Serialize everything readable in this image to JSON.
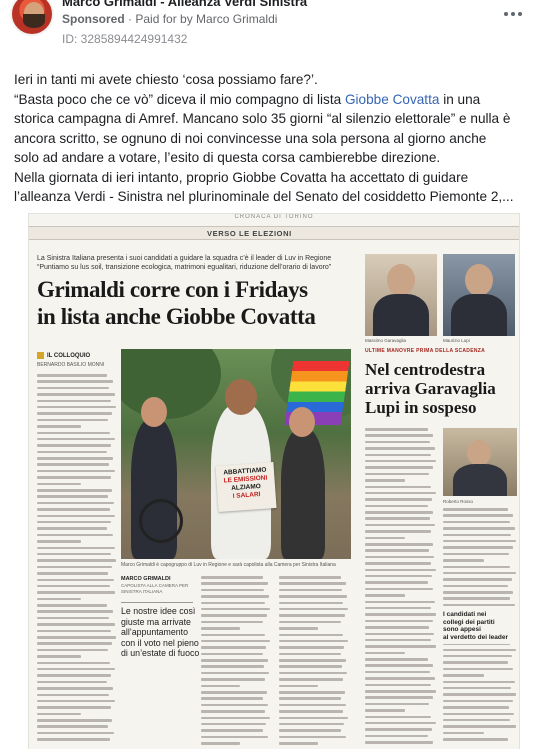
{
  "header": {
    "page_name": "Marco Grimaldi - Alleanza Verdi Sinistra",
    "sponsored": "Sponsored",
    "paid_for": "Paid for by Marco Grimaldi",
    "ad_id": "ID: 3285894424991432"
  },
  "post": {
    "line1": "Ieri in tanti mi avete chiesto ‘cosa possiamo fare?’.",
    "line2_pre": "“Basta poco che ce vò” diceva il mio compagno di lista ",
    "line2_link": "Giobbe Covatta",
    "line2_post": " in una",
    "line3": "storica campagna di Amref. Mancano solo 35 giorni “al silenzio elettorale” e nulla è",
    "line4": "ancora scritto, se ognuno di noi convincesse una sola persona al giorno anche",
    "line5": "solo ad andare a votare, l’esito di questa corsa cambierebbe direzione.",
    "line6": "Nella giornata di ieri intanto, proprio Giobbe Covatta ha accettato di guidare",
    "line7": "l’alleanza Verdi - Sinistra nel plurinominale del Senato del cosiddetto Piemonte 2,..."
  },
  "newspaper": {
    "top_label": "CRONACA DI TORINO",
    "section": "VERSO LE ELEZIONI",
    "kicker1": "La Sinistra Italiana presenta i suoi candidati a guidare la squadra c’è il leader di Luv in Regione",
    "kicker2": "“Puntiamo su lus soil, transizione ecologica, matrimoni egualitari, riduzione dell’orario di lavoro”",
    "headline1": "Grimaldi corre con i Fridays",
    "headline2": "in lista anche Giobbe Covatta",
    "interview_tag": "IL COLLOQUIO",
    "byline": "BERNARDO BASILIO MONNI",
    "sign_line1": "ABBATTIAMO",
    "sign_line2": "LE EMISSIONI",
    "sign_line3": "ALZIAMO",
    "sign_line4": "I SALARI",
    "photo_caption": "Marco Grimaldi è capogruppo di Luv in Regione e sarà capolista alla Camera per Sinistra Italiana",
    "bio_name": "MARCO GRIMALDI",
    "bio_role": "CAPOLISTA ALLA CAMERA PER SINISTRA ITALIANA",
    "quote1": "Le nostre idee così",
    "quote2": "giuste ma arrivate",
    "quote3": "all’appuntamento",
    "quote4": "con il voto nel pieno",
    "quote5": "di un’estate di fuoco",
    "right_cap1": "Massimo Garavaglia",
    "right_cap2": "Maurizio Lupi",
    "right_kicker": "ULTIME MANOVRE PRIMA DELLA SCADENZA",
    "right_head1": "Nel centrodestra",
    "right_head2": "arriva Garavaglia",
    "right_head3": "Lupi in sospeso",
    "right_photo2_cap": "Roberto Rosso",
    "mini1": "I candidati nei",
    "mini2": "collegi dei partiti",
    "mini3": "sono appesi",
    "mini4": "al verdetto dei leader"
  }
}
